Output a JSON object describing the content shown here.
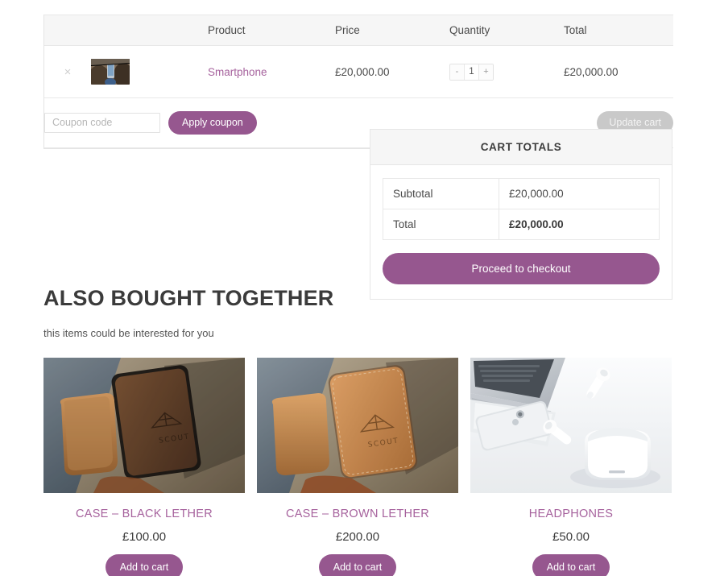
{
  "cart_table": {
    "headers": {
      "remove": "",
      "thumbnail": "",
      "product": "Product",
      "price": "Price",
      "quantity": "Quantity",
      "total": "Total"
    },
    "rows": [
      {
        "remove_label": "×",
        "product_name": "Smartphone",
        "price": "£20,000.00",
        "qty_decrement": "-",
        "qty_value": "1",
        "qty_increment": "+",
        "line_total": "£20,000.00"
      }
    ],
    "coupon": {
      "placeholder": "Coupon code",
      "value": "",
      "apply_label": "Apply coupon",
      "update_label": "Update cart"
    }
  },
  "cart_totals": {
    "title": "CART TOTALS",
    "rows": [
      {
        "label": "Subtotal",
        "value": "£20,000.00"
      },
      {
        "label": "Total",
        "value": "£20,000.00"
      }
    ],
    "checkout_label": "Proceed to checkout"
  },
  "related": {
    "heading": "ALSO BOUGHT TOGETHER",
    "subheading": "this items could be interested for you",
    "products": [
      {
        "title": "CASE – BLACK LETHER",
        "price": "£100.00",
        "button_label": "Add to cart"
      },
      {
        "title": "CASE – BROWN LETHER",
        "price": "£200.00",
        "button_label": "Add to cart"
      },
      {
        "title": "HEADPHONES",
        "price": "£50.00",
        "button_label": "Add to cart"
      }
    ]
  },
  "colors": {
    "accent": "#96578f",
    "link": "#a6629d",
    "disabled": "#c9c9c9",
    "header_bg": "#f6f6f6",
    "border": "#e6e6e6"
  }
}
